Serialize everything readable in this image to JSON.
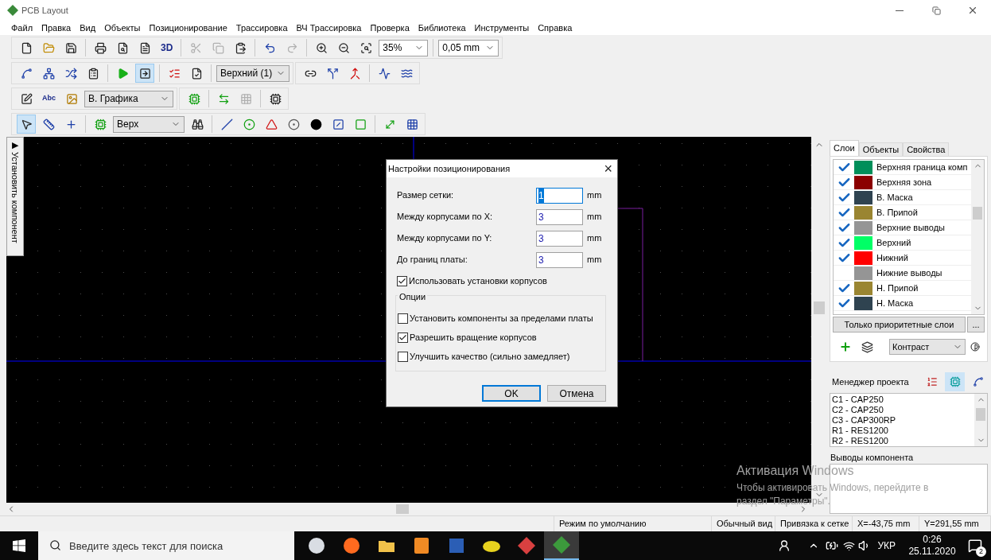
{
  "window": {
    "title": "PCB Layout"
  },
  "menu": [
    "Файл",
    "Правка",
    "Вид",
    "Объекты",
    "Позиционирование",
    "Трассировка",
    "ВЧ Трассировка",
    "Проверка",
    "Библиотека",
    "Инструменты",
    "Справка"
  ],
  "toolbar_rows": [
    {
      "toolbars": [
        {
          "items": [
            {
              "kind": "button",
              "pressed": false,
              "disabled": false
            },
            {
              "kind": "button",
              "pressed": false,
              "disabled": false
            },
            {
              "kind": "button",
              "pressed": false,
              "disabled": false
            },
            {
              "kind": "separator"
            },
            {
              "kind": "button",
              "pressed": false,
              "disabled": false
            },
            {
              "kind": "button",
              "pressed": false,
              "disabled": false
            },
            {
              "kind": "button",
              "pressed": false,
              "disabled": false
            },
            {
              "kind": "text_button",
              "label": "3D",
              "pressed": false,
              "disabled": false
            },
            {
              "kind": "separator"
            },
            {
              "kind": "button",
              "pressed": false,
              "disabled": true
            },
            {
              "kind": "button",
              "pressed": false,
              "disabled": true
            },
            {
              "kind": "button",
              "pressed": false,
              "disabled": false
            },
            {
              "kind": "separator"
            },
            {
              "kind": "button",
              "pressed": false,
              "disabled": false
            },
            {
              "kind": "button",
              "pressed": false,
              "disabled": true
            },
            {
              "kind": "separator"
            },
            {
              "kind": "button",
              "pressed": false,
              "disabled": false
            },
            {
              "kind": "button",
              "pressed": false,
              "disabled": false
            },
            {
              "kind": "button",
              "pressed": false,
              "disabled": false
            },
            {
              "kind": "combo",
              "value": "35%"
            },
            {
              "kind": "separator"
            },
            {
              "kind": "combo",
              "value": "0,05 mm"
            }
          ]
        }
      ]
    },
    {
      "toolbars": [
        {
          "items": [
            {
              "kind": "button",
              "pressed": false,
              "disabled": false
            },
            {
              "kind": "button",
              "pressed": false,
              "disabled": false
            },
            {
              "kind": "button",
              "pressed": false,
              "disabled": false
            },
            {
              "kind": "button",
              "pressed": false,
              "disabled": false
            },
            {
              "kind": "separator"
            },
            {
              "kind": "button",
              "pressed": false,
              "disabled": false
            },
            {
              "kind": "button",
              "pressed": true,
              "disabled": false
            },
            {
              "kind": "separator"
            },
            {
              "kind": "button",
              "pressed": false,
              "disabled": false
            },
            {
              "kind": "button",
              "pressed": false,
              "disabled": false
            },
            {
              "kind": "separator"
            },
            {
              "kind": "combo",
              "value": "Верхний (1)"
            }
          ]
        },
        {
          "items": [
            {
              "kind": "button",
              "pressed": false,
              "disabled": false
            },
            {
              "kind": "button",
              "pressed": false,
              "disabled": false
            },
            {
              "kind": "button",
              "pressed": false,
              "disabled": false
            },
            {
              "kind": "separator"
            },
            {
              "kind": "button",
              "pressed": false,
              "disabled": false
            },
            {
              "kind": "button",
              "pressed": false,
              "disabled": false
            }
          ]
        }
      ]
    },
    {
      "toolbars": [
        {
          "items": [
            {
              "kind": "button",
              "pressed": false,
              "disabled": false
            },
            {
              "kind": "text_button",
              "label": "Abc",
              "pressed": false,
              "disabled": false
            },
            {
              "kind": "button",
              "pressed": false,
              "disabled": false
            },
            {
              "kind": "combo",
              "value": "В. Графика"
            }
          ]
        },
        {
          "items": [
            {
              "kind": "button",
              "pressed": false,
              "disabled": false
            },
            {
              "kind": "separator"
            },
            {
              "kind": "button",
              "pressed": false,
              "disabled": false
            },
            {
              "kind": "button",
              "pressed": false,
              "disabled": true
            },
            {
              "kind": "separator"
            },
            {
              "kind": "button",
              "pressed": false,
              "disabled": false
            }
          ]
        }
      ]
    },
    {
      "toolbars": [
        {
          "items": [
            {
              "kind": "button",
              "pressed": true,
              "disabled": false
            },
            {
              "kind": "button",
              "pressed": false,
              "disabled": false
            },
            {
              "kind": "button",
              "pressed": false,
              "disabled": false
            },
            {
              "kind": "separator"
            },
            {
              "kind": "button",
              "pressed": false,
              "disabled": false
            },
            {
              "kind": "combo",
              "value": "Верх"
            },
            {
              "kind": "button",
              "pressed": false,
              "disabled": false
            },
            {
              "kind": "separator"
            },
            {
              "kind": "button",
              "pressed": false,
              "disabled": false
            },
            {
              "kind": "button",
              "pressed": false,
              "disabled": false
            },
            {
              "kind": "button",
              "pressed": false,
              "disabled": false
            },
            {
              "kind": "button",
              "pressed": false,
              "disabled": false
            },
            {
              "kind": "button",
              "pressed": false,
              "disabled": false
            },
            {
              "kind": "button",
              "pressed": false,
              "disabled": false
            },
            {
              "kind": "button",
              "pressed": false,
              "disabled": false
            },
            {
              "kind": "separator"
            },
            {
              "kind": "button",
              "pressed": false,
              "disabled": false
            },
            {
              "kind": "button",
              "pressed": false,
              "disabled": false
            }
          ]
        }
      ]
    }
  ],
  "side_tab": {
    "arrow": "▶",
    "label": "Установить компонент"
  },
  "dialog": {
    "title": "Настройки позиционирования",
    "close": "×",
    "fields": [
      {
        "label": "Размер сетки:",
        "value": "1",
        "unit": "mm",
        "focused": true
      },
      {
        "label": "Между корпусами по X:",
        "value": "3",
        "unit": "mm",
        "focused": false
      },
      {
        "label": "Между корпусами по Y:",
        "value": "3",
        "unit": "mm",
        "focused": false
      },
      {
        "label": "До границ платы:",
        "value": "3",
        "unit": "mm",
        "focused": false
      }
    ],
    "use_package_settings": {
      "label": "Использовать установки корпусов",
      "checked": true
    },
    "group": {
      "title": "Опции",
      "options": [
        {
          "label": "Установить компоненты за пределами платы",
          "checked": false
        },
        {
          "label": "Разрешить вращение корпусов",
          "checked": true
        },
        {
          "label": "Улучшить качество (сильно замедляет)",
          "checked": false
        }
      ]
    },
    "buttons": [
      {
        "label": "OK",
        "default": true
      },
      {
        "label": "Отмена",
        "default": false
      }
    ]
  },
  "right_panel": {
    "tabs": [
      {
        "label": "Слои",
        "selected": true
      },
      {
        "label": "Объекты",
        "selected": false
      },
      {
        "label": "Свойства",
        "selected": false
      }
    ],
    "layers": [
      {
        "name": "Верхняя граница комп",
        "color": "#008f5a",
        "checked": true
      },
      {
        "name": "Верхняя зона",
        "color": "#8b0000",
        "checked": true
      },
      {
        "name": "В. Маска",
        "color": "#2f4350",
        "checked": true
      },
      {
        "name": "В. Припой",
        "color": "#9a8531",
        "checked": true
      },
      {
        "name": "Верхние выводы",
        "color": "#959595",
        "checked": true
      },
      {
        "name": "Верхний",
        "color": "#00ff66",
        "checked": true
      },
      {
        "name": "Нижний",
        "color": "#ff0000",
        "checked": true
      },
      {
        "name": "Нижние выводы",
        "color": "#959595",
        "checked": false
      },
      {
        "name": "Н. Припой",
        "color": "#9a8531",
        "checked": true
      },
      {
        "name": "Н. Маска",
        "color": "#2f4350",
        "checked": true
      }
    ],
    "priority_button": "Только приоритетные слои",
    "more_button": "...",
    "contrast_combo": "Контраст",
    "project_manager": {
      "title": "Менеджер проекта",
      "buttons": [
        {
          "pressed": false
        },
        {
          "pressed": true
        },
        {
          "pressed": false
        }
      ],
      "items": [
        "C1 - CAP250",
        "C2 - CAP250",
        "C3 - CAP300RP",
        "R1 - RES1200",
        "R2 - RES1200"
      ]
    },
    "pins_title": "Выводы компонента"
  },
  "activation": {
    "title": "Активация Windows",
    "line_1": "Чтобы активировать Windows, перейдите в",
    "line_2": "раздел \"Параметры\"."
  },
  "status_bar": [
    "Режим по умолчанию",
    "Обычный вид",
    "Привязка к сетке",
    "X=-43,75 mm",
    "Y=291,55 mm"
  ],
  "taskbar": {
    "search_placeholder": "Введите здесь текст для поиска",
    "apps": [
      {
        "active": false
      },
      {
        "active": false
      },
      {
        "active": false
      },
      {
        "active": false
      },
      {
        "active": false
      },
      {
        "active": false
      },
      {
        "active": false
      },
      {
        "active": true
      }
    ],
    "language": "УКР",
    "time": "0:26",
    "date": "25.11.2020",
    "notifications": "2"
  }
}
